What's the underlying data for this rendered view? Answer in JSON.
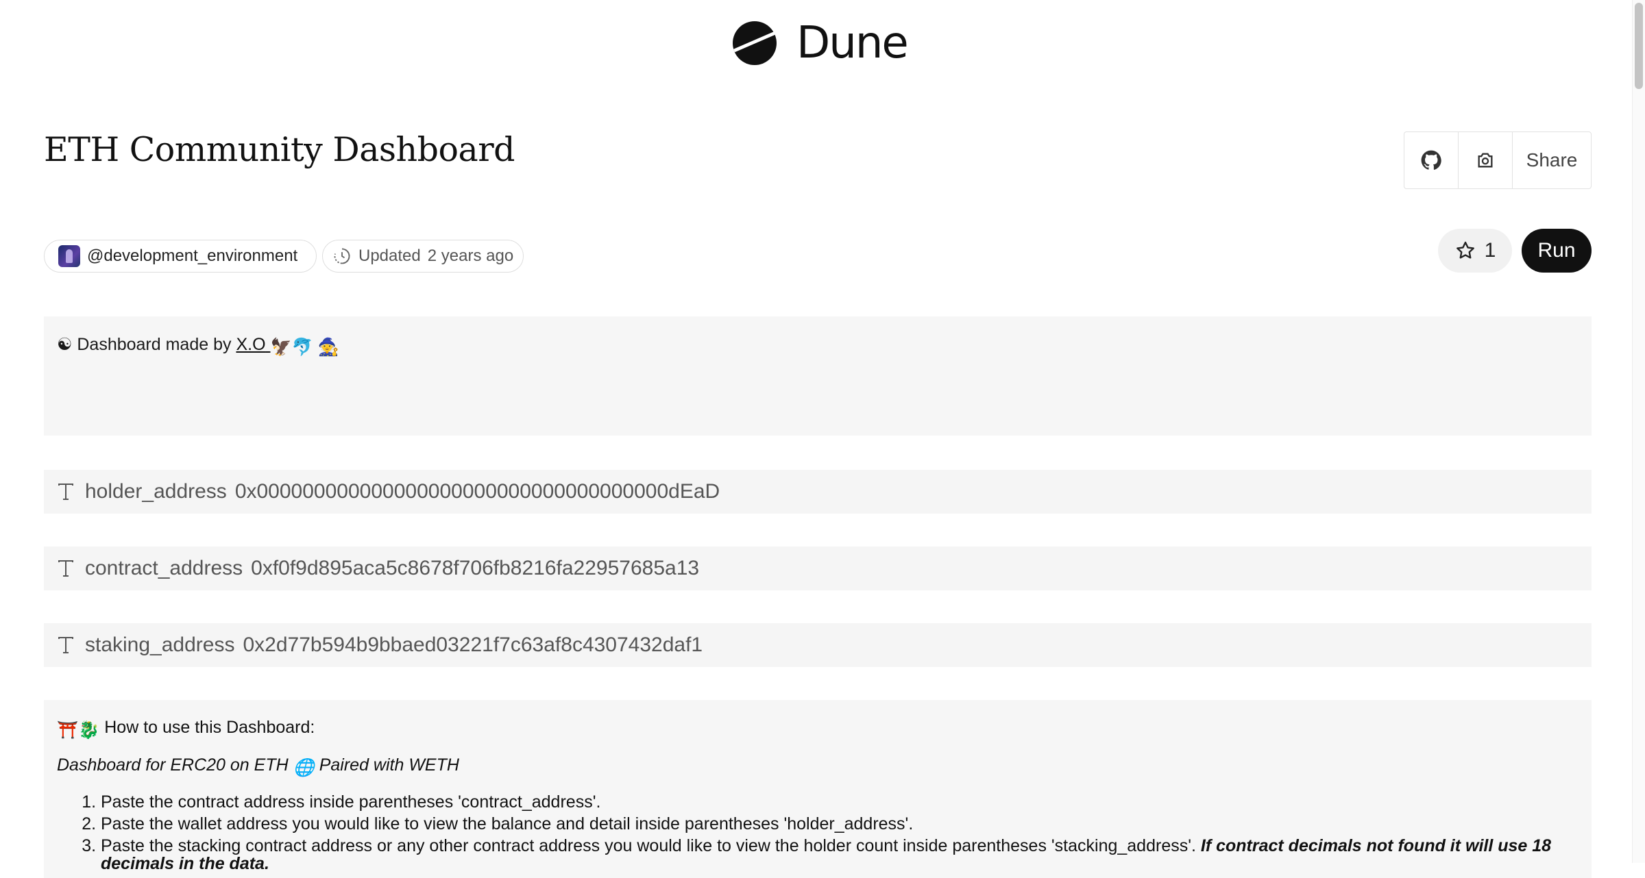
{
  "brand": {
    "name": "Dune"
  },
  "dashboard": {
    "title": "ETH Community Dashboard",
    "owner": "@development_environment",
    "updated_label": "Updated",
    "updated_time": "2 years ago",
    "stars": "1"
  },
  "toolbar": {
    "share_label": "Share",
    "run_label": "Run"
  },
  "text_widget": {
    "prefix": "☯ Dashboard made by",
    "author_link": "X.O"
  },
  "params": [
    {
      "name": "holder_address",
      "value": "0x000000000000000000000000000000000000dEaD"
    },
    {
      "name": "contract_address",
      "value": "0xf0f9d895aca5c8678f706fb8216fa22957685a13"
    },
    {
      "name": "staking_address",
      "value": "0x2d77b594b9bbaed03221f7c63af8c4307432daf1"
    }
  ],
  "howto": {
    "heading": "How to use this Dashboard:",
    "subtitle_a": "Dashboard for ERC20 on ETH",
    "subtitle_b": "Paired with WETH",
    "steps": [
      "Paste the contract address inside parentheses 'contract_address'.",
      "Paste the wallet address you would like to view the balance and detail inside parentheses 'holder_address'.",
      "Paste the stacking contract address or any other contract address you would like to view the holder count inside parentheses 'stacking_address'."
    ],
    "step3_note": "If contract decimals not found it will use 18 decimals in the data."
  },
  "colors": {
    "accent": "#111111",
    "panel": "#f6f6f6",
    "border": "#e2e2e2"
  },
  "icons": [
    "dune-logo-icon",
    "github-icon",
    "camera-icon",
    "clock-icon",
    "star-icon",
    "text-param-icon"
  ]
}
